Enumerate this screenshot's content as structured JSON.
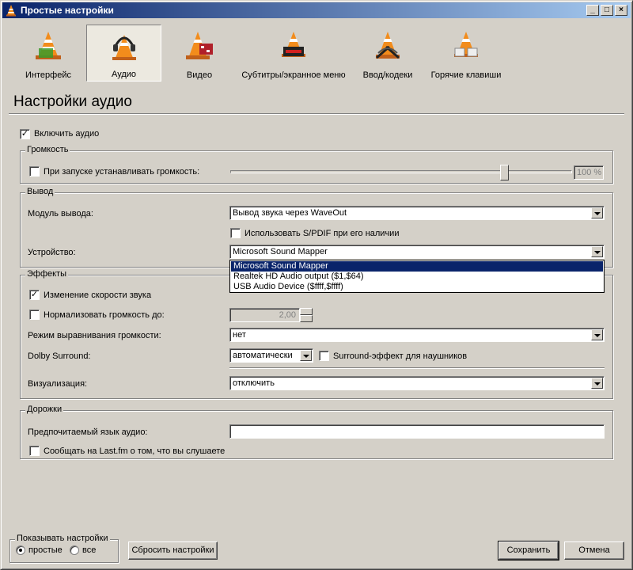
{
  "window": {
    "title": "Простые настройки"
  },
  "categories": [
    {
      "label": "Интерфейс",
      "icon": "cone-interface-icon",
      "selected": false
    },
    {
      "label": "Аудио",
      "icon": "cone-headphones-icon",
      "selected": true
    },
    {
      "label": "Видео",
      "icon": "cone-video-icon",
      "selected": false
    },
    {
      "label": "Субтитры/экранное меню",
      "icon": "cone-subtitles-icon",
      "selected": false
    },
    {
      "label": "Ввод/кодеки",
      "icon": "cone-codecs-icon",
      "selected": false
    },
    {
      "label": "Горячие клавиши",
      "icon": "cone-hotkeys-icon",
      "selected": false
    }
  ],
  "page_title": "Настройки аудио",
  "enable_audio": {
    "label": "Включить аудио",
    "checked": true
  },
  "volume": {
    "group_title": "Громкость",
    "startup_label": "При запуске устанавливать громкость:",
    "startup_checked": false,
    "value_text": "100 %",
    "slider_fraction": 0.8
  },
  "output": {
    "group_title": "Вывод",
    "module_label": "Модуль вывода:",
    "module_value": "Вывод звука через WaveOut",
    "spdif_label": "Использовать S/PDIF при его наличии",
    "spdif_checked": false,
    "device_label": "Устройство:",
    "device_value": "Microsoft Sound Mapper",
    "device_options": [
      "Microsoft Sound Mapper",
      "Realtek HD Audio output ($1,$64)",
      "USB Audio Device ($ffff,$ffff)"
    ]
  },
  "effects": {
    "group_title": "Эффекты",
    "pitch_label": "Изменение скорости звука",
    "pitch_checked": true,
    "normalize_label": "Нормализовать громкость до:",
    "normalize_checked": false,
    "normalize_value": "2,00",
    "replay_label": "Режим выравнивания громкости:",
    "replay_value": "нет",
    "dolby_label": "Dolby Surround:",
    "dolby_value": "автоматически",
    "headphone_label": "Surround-эффект для наушников",
    "headphone_checked": false,
    "visual_label": "Визуализация:",
    "visual_value": "отключить"
  },
  "tracks": {
    "group_title": "Дорожки",
    "lang_label": "Предпочитаемый язык аудио:",
    "lang_value": "",
    "lastfm_label": "Сообщать на Last.fm о том, что вы слушаете",
    "lastfm_checked": false
  },
  "show_settings": {
    "group_title": "Показывать настройки",
    "simple_label": "простые",
    "all_label": "все",
    "selected": "simple"
  },
  "buttons": {
    "reset": "Сбросить настройки",
    "save": "Сохранить",
    "cancel": "Отмена"
  },
  "colors": {
    "title_start": "#0a246a",
    "title_end": "#a6caf0",
    "cone_orange": "#f28c1c",
    "selection": "#0a246a"
  }
}
